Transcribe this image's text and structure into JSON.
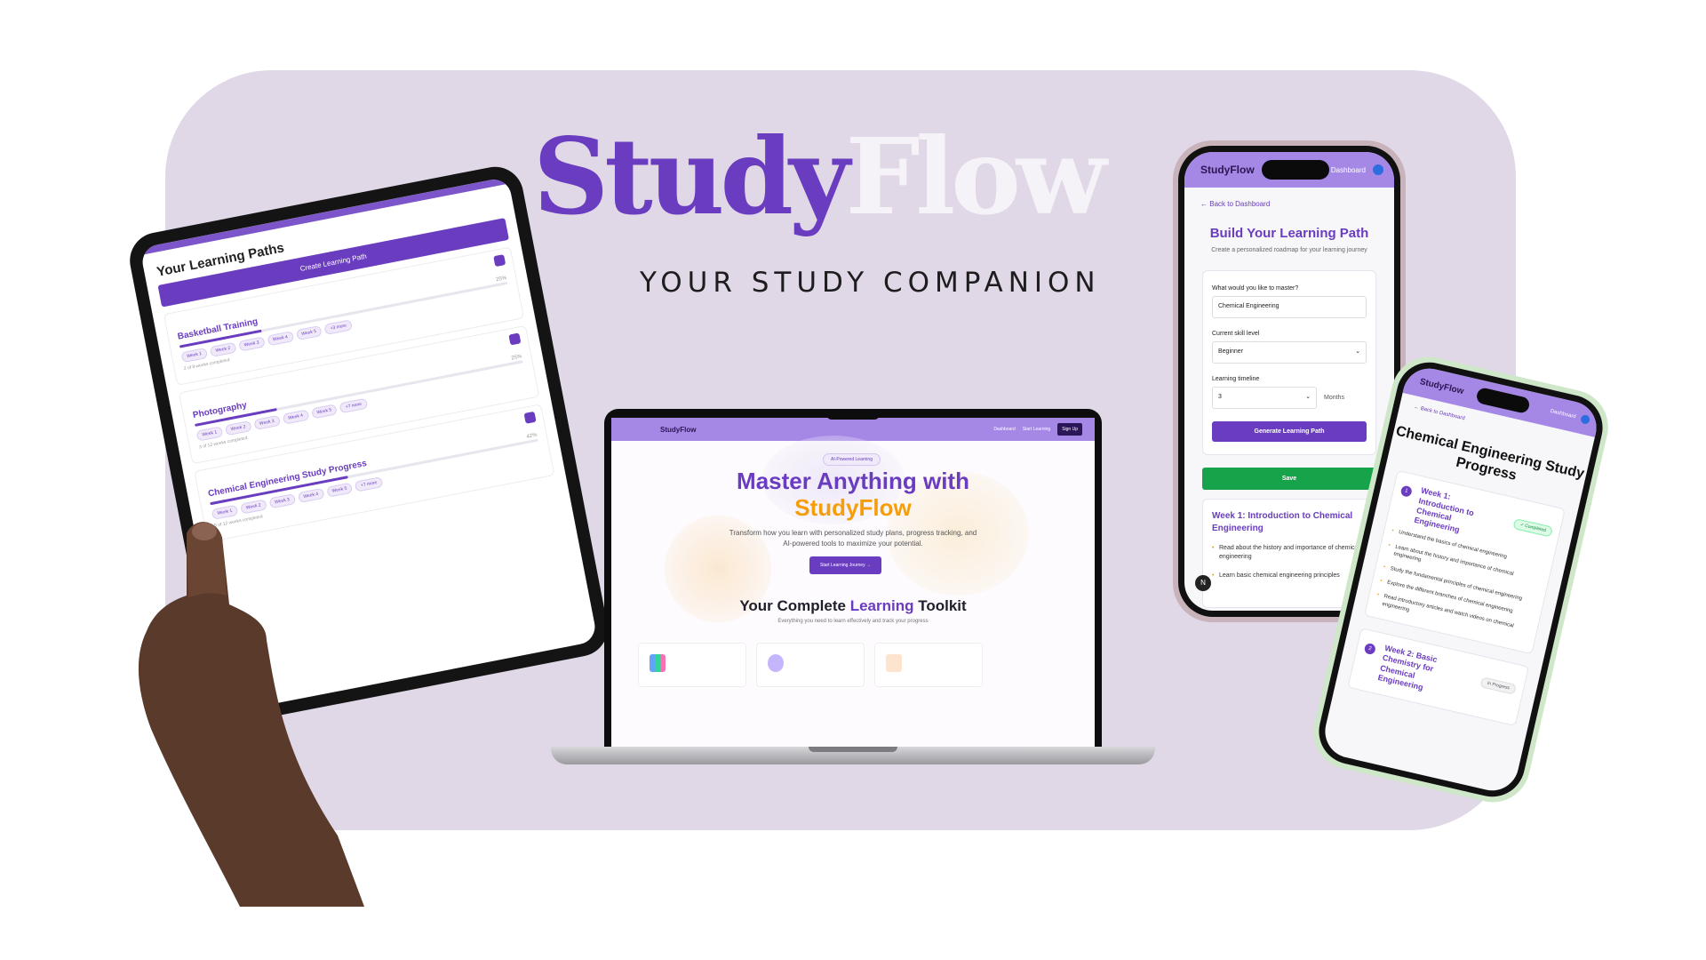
{
  "brand": {
    "part1": "Study",
    "part2": "Flow",
    "tagline": "YOUR STUDY COMPANION"
  },
  "colors": {
    "primary": "#6a3cc0",
    "accent": "#f59e0b",
    "success": "#16a34a",
    "panel": "#e1d8e7"
  },
  "tablet": {
    "heading": "Your Learning Paths",
    "create_button": "Create Learning Path",
    "paths": [
      {
        "title": "Basketball Training",
        "weeks": [
          "Week 1",
          "Week 2",
          "Week 3",
          "Week 4",
          "Week 5",
          "+3 more"
        ],
        "percent": "25%",
        "progress": 0.25,
        "completed": "2 of 8 weeks completed"
      },
      {
        "title": "Photography",
        "weeks": [
          "Week 1",
          "Week 2",
          "Week 3",
          "Week 4",
          "Week 5",
          "+7 more"
        ],
        "percent": "25%",
        "progress": 0.25,
        "completed": "3 of 12 weeks completed"
      },
      {
        "title": "Chemical Engineering Study Progress",
        "weeks": [
          "Week 1",
          "Week 2",
          "Week 3",
          "Week 4",
          "Week 5",
          "+7 more"
        ],
        "percent": "42%",
        "progress": 0.42,
        "completed": "5 of 12 weeks completed"
      }
    ]
  },
  "laptop": {
    "nav_brand": "StudyFlow",
    "nav_links": [
      "Dashboard",
      "Start Learning"
    ],
    "signup": "Sign Up",
    "badge": "AI-Powered Learning",
    "hero_line1": "Master Anything with",
    "hero_line2": "StudyFlow",
    "description": "Transform how you learn with personalized study plans, progress tracking, and AI-powered tools to maximize your potential.",
    "cta": "Start Learning Journey →",
    "toolkit_pre": "Your Complete ",
    "toolkit_accent": "Learning",
    "toolkit_post": " Toolkit",
    "toolkit_sub": "Everything you need to learn effectively and track your progress"
  },
  "phone1": {
    "nav_brand": "StudyFlow",
    "nav_dashboard": "Dashboard",
    "back": "Back to Dashboard",
    "title": "Build Your Learning Path",
    "subtitle": "Create a personalized roadmap for your learning journey",
    "q_master": "What would you like to master?",
    "master_value": "Chemical Engineering",
    "skill_label": "Current skill level",
    "skill_value": "Beginner",
    "timeline_label": "Learning timeline",
    "timeline_value": "3",
    "timeline_unit": "Months",
    "generate": "Generate Learning Path",
    "save": "Save",
    "week_title": "Week 1: Introduction to Chemical Engineering",
    "items": [
      "Read about the history and importance of chemical engineering",
      "Learn basic chemical engineering principles"
    ],
    "n_badge": "N"
  },
  "phone2": {
    "nav_brand": "StudyFlow",
    "nav_dashboard": "Dashboard",
    "back": "Back to Dashboard",
    "title": "Chemical Engineering Study Progress",
    "week1": {
      "num": "1",
      "title": "Week 1: Introduction to Chemical Engineering",
      "status": "✓ Completed",
      "items": [
        "Understand the basics of chemical engineering",
        "Learn about the history and importance of chemical engineering",
        "Study the fundamental principles of chemical engineering",
        "Explore the different branches of chemical engineering",
        "Read introductory articles and watch videos on chemical engineering"
      ]
    },
    "week2": {
      "num": "2",
      "title": "Week 2: Basic Chemistry for Chemical Engineering",
      "status": "In Progress"
    }
  }
}
